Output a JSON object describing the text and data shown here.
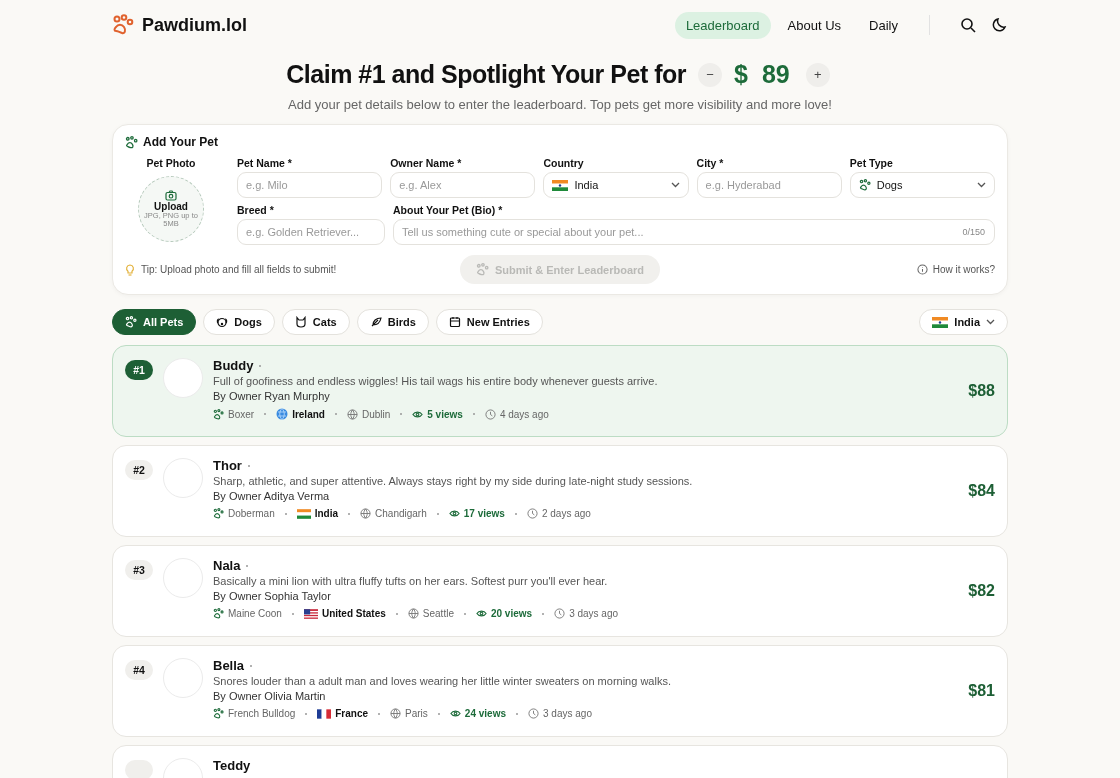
{
  "brand": "Pawdium.lol",
  "nav": [
    {
      "label": "Leaderboard",
      "selected": true
    },
    {
      "label": "About Us",
      "selected": false
    },
    {
      "label": "Daily",
      "selected": false
    }
  ],
  "hero": {
    "title": "Claim #1 and Spotlight Your Pet for",
    "minus": "−",
    "currency": "$",
    "price": "89",
    "plus": "+",
    "subtitle": "Add your pet details below to enter the leaderboard. Top pets get more visibility and more love!"
  },
  "form": {
    "title": "Add Your Pet",
    "photo_label": "Pet Photo",
    "upload": "Upload",
    "upload_hint": "JPG, PNG up to 5MB",
    "fields": [
      {
        "label": "Pet Name *",
        "kind": "input",
        "placeholder": "e.g. Milo"
      },
      {
        "label": "Owner Name *",
        "kind": "input",
        "placeholder": "e.g. Alex"
      },
      {
        "label": "Country",
        "kind": "select",
        "value": "India"
      },
      {
        "label": "City *",
        "kind": "input",
        "placeholder": "e.g. Hyderabad"
      },
      {
        "label": "Pet Type",
        "kind": "select",
        "value": "Dogs"
      }
    ],
    "breed": {
      "label": "Breed *",
      "placeholder": "e.g. Golden Retriever..."
    },
    "bio": {
      "label": "About Your Pet (Bio) *",
      "placeholder": "Tell us something cute or special about your pet...",
      "counter": "0/150"
    },
    "tip": "Tip: Upload photo and fill all fields to submit!",
    "submit": "Submit & Enter Leaderboard",
    "submit_disabled": true,
    "help": "How it works?"
  },
  "filters": [
    {
      "label": "All Pets",
      "selected": true
    },
    {
      "label": "Dogs",
      "selected": false
    },
    {
      "label": "Cats",
      "selected": false
    },
    {
      "label": "Birds",
      "selected": false
    },
    {
      "label": "New Entries",
      "selected": false
    }
  ],
  "country_filter": {
    "value": "India"
  },
  "entries": [
    {
      "rank": "#1",
      "name": "Buddy",
      "bio": "Full of goofiness and endless wiggles! His tail wags his entire body whenever guests arrive.",
      "owner": "By Owner Ryan Murphy",
      "price": "$88",
      "highlighted": true,
      "meta": [
        {
          "kind": "breed",
          "text": "Boxer"
        },
        {
          "kind": "globe",
          "text": "Ireland"
        },
        {
          "kind": "city",
          "text": "Dublin"
        },
        {
          "kind": "views",
          "text": "5 views"
        },
        {
          "kind": "time",
          "text": "4 days ago"
        }
      ]
    },
    {
      "rank": "#2",
      "name": "Thor",
      "bio": "Sharp, athletic, and super attentive. Always stays right by my side during late-night study sessions.",
      "owner": "By Owner Aditya Verma",
      "price": "$84",
      "highlighted": false,
      "meta": [
        {
          "kind": "breed",
          "text": "Doberman"
        },
        {
          "kind": "india",
          "text": "India"
        },
        {
          "kind": "city",
          "text": "Chandigarh"
        },
        {
          "kind": "views",
          "text": "17 views"
        },
        {
          "kind": "time",
          "text": "2 days ago"
        }
      ]
    },
    {
      "rank": "#3",
      "name": "Nala",
      "bio": "Basically a mini lion with ultra fluffy tufts on her ears. Softest purr you'll ever hear.",
      "owner": "By Owner Sophia Taylor",
      "price": "$82",
      "highlighted": false,
      "meta": [
        {
          "kind": "breed",
          "text": "Maine Coon"
        },
        {
          "kind": "usa",
          "text": "United States"
        },
        {
          "kind": "city",
          "text": "Seattle"
        },
        {
          "kind": "views",
          "text": "20 views"
        },
        {
          "kind": "time",
          "text": "3 days ago"
        }
      ]
    },
    {
      "rank": "#4",
      "name": "Bella",
      "bio": "Snores louder than a adult man and loves wearing her little winter sweaters on morning walks.",
      "owner": "By Owner Olivia Martin",
      "price": "$81",
      "highlighted": false,
      "meta": [
        {
          "kind": "breed",
          "text": "French Bulldog"
        },
        {
          "kind": "france",
          "text": "France"
        },
        {
          "kind": "city",
          "text": "Paris"
        },
        {
          "kind": "views",
          "text": "24 views"
        },
        {
          "kind": "time",
          "text": "3 days ago"
        }
      ]
    },
    {
      "name": "Teddy",
      "highlighted": false
    }
  ]
}
